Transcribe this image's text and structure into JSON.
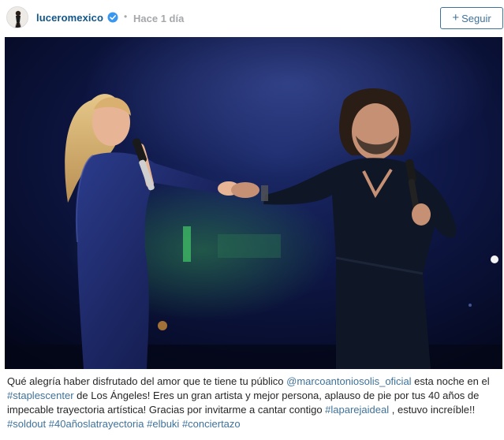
{
  "post": {
    "username": "luceromexico",
    "separator": "•",
    "time": "Hace 1 día",
    "follow_label": "Seguir",
    "follow_icon": "plus-icon",
    "verified_icon": "verified-badge-icon",
    "brand_color": "#125688",
    "link_color": "#3f729b"
  },
  "caption": {
    "t1": "Qué alegría haber disfrutado del amor que te tiene tu público ",
    "mention1": "@marcoantoniosolis_oficial",
    "t2": " esta noche en el ",
    "tag1": "#staplescenter",
    "t3": " de Los Ángeles! Eres un gran artista y mejor persona, aplauso de pie por tus 40 años de impecable trayectoria artística! Gracias por invitarme a cantar contigo ",
    "tag2": "#laparejaideal",
    "t4": " , estuvo increíble!! ",
    "tag3": "#soldout",
    "tag4": "#40añoslatrayectoria",
    "tag5": "#elbuki",
    "tag6": "#conciertazo"
  }
}
